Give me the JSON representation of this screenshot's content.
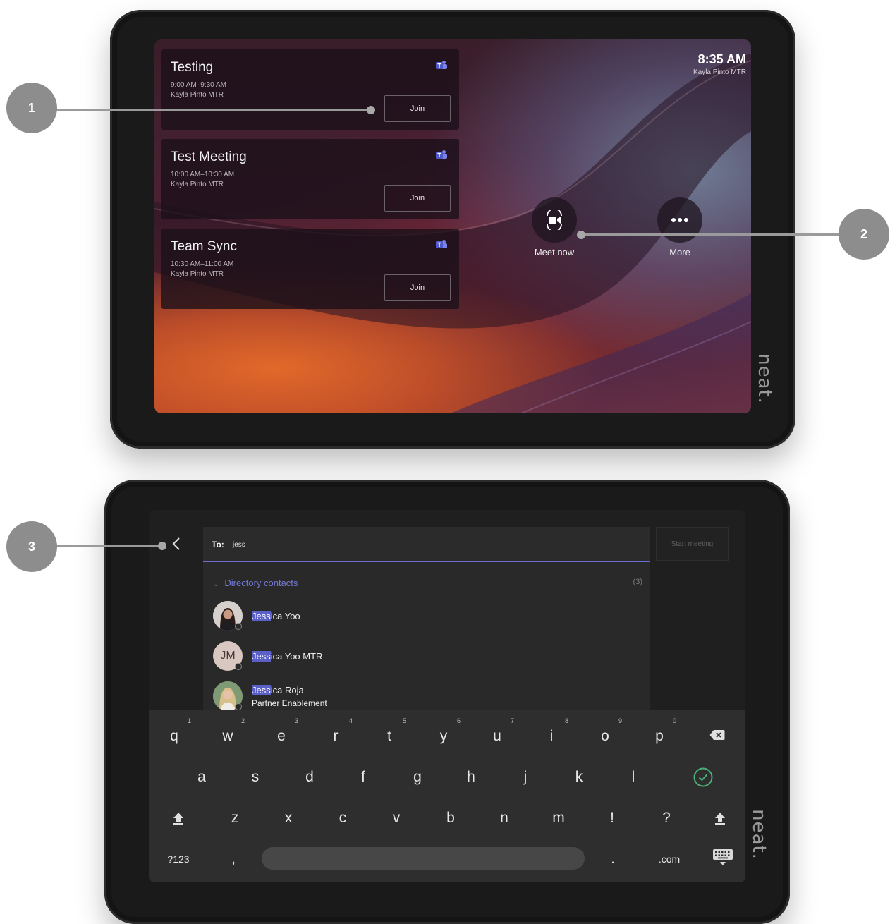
{
  "top_screen": {
    "clock": {
      "time": "8:35 AM",
      "room": "Kayla Pinto MTR"
    },
    "meetings": [
      {
        "title": "Testing",
        "time": "9:00 AM–9:30 AM",
        "room": "Kayla Pinto MTR",
        "join_label": "Join"
      },
      {
        "title": "Test Meeting",
        "time": "10:00 AM–10:30 AM",
        "room": "Kayla Pinto MTR",
        "join_label": "Join"
      },
      {
        "title": "Team Sync",
        "time": "10:30 AM–11:00 AM",
        "room": "Kayla Pinto MTR",
        "join_label": "Join"
      }
    ],
    "actions": {
      "meet_now": "Meet now",
      "more": "More"
    },
    "brand": "neat."
  },
  "callouts": {
    "one": "1",
    "two": "2",
    "three": "3"
  },
  "bottom_screen": {
    "to_label": "To:",
    "to_value": "jess",
    "start_meeting": "Start meeting",
    "directory": {
      "header": "Directory contacts",
      "count": "(3)"
    },
    "contacts": [
      {
        "name_match": "Jess",
        "name_rest": "ica Yoo",
        "subtitle": ""
      },
      {
        "name_match": "Jess",
        "name_rest": "ica Yoo MTR",
        "initials": "JM",
        "subtitle": ""
      },
      {
        "name_match": "Jess",
        "name_rest": "ica Roja",
        "subtitle": "Partner Enablement"
      }
    ],
    "keyboard": {
      "row1": [
        "q",
        "w",
        "e",
        "r",
        "t",
        "y",
        "u",
        "i",
        "o",
        "p"
      ],
      "row1_hints": [
        "1",
        "2",
        "3",
        "4",
        "5",
        "6",
        "7",
        "8",
        "9",
        "0"
      ],
      "row2": [
        "a",
        "s",
        "d",
        "f",
        "g",
        "h",
        "j",
        "k",
        "l"
      ],
      "row3": [
        "z",
        "x",
        "c",
        "v",
        "b",
        "n",
        "m",
        "!",
        "?"
      ],
      "symbols_label": "?123",
      "comma": ",",
      "period": ".",
      "dotcom": ".com"
    },
    "brand": "neat."
  },
  "colors": {
    "accent": "#6b6fcf",
    "highlight": "#5b60c9",
    "callout": "#8d8d8d"
  }
}
